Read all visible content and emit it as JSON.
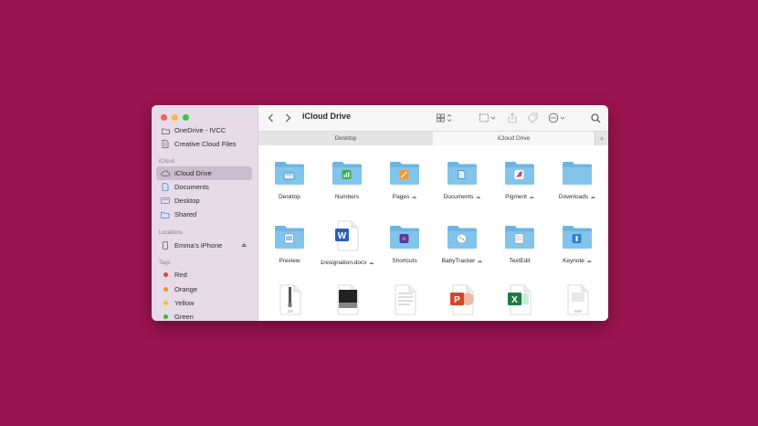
{
  "colors": {
    "background": "#9a1450",
    "folder": "#6db5e0",
    "selected": "#cbbdcd"
  },
  "sidebar": {
    "top_items": [
      {
        "label": "OneDrive - IVCC",
        "icon": "folder-icon"
      },
      {
        "label": "Creative Cloud Files",
        "icon": "document-icon"
      }
    ],
    "icloud_heading": "iCloud",
    "icloud_items": [
      {
        "label": "iCloud Drive",
        "icon": "cloud-icon",
        "selected": true
      },
      {
        "label": "Documents",
        "icon": "document-icon"
      },
      {
        "label": "Desktop",
        "icon": "desktop-icon"
      },
      {
        "label": "Shared",
        "icon": "shared-folder-icon"
      }
    ],
    "locations_heading": "Locations",
    "location_items": [
      {
        "label": "Emma's iPhone",
        "icon": "iphone-icon"
      }
    ],
    "tags_heading": "Tags",
    "tags": [
      {
        "label": "Red",
        "color": "#e8423a"
      },
      {
        "label": "Orange",
        "color": "#f0922c"
      },
      {
        "label": "Yellow",
        "color": "#f2c42c"
      },
      {
        "label": "Green",
        "color": "#3cb44a"
      }
    ]
  },
  "toolbar": {
    "title": "iCloud Drive"
  },
  "tabs": [
    {
      "label": "Desktop",
      "active": false
    },
    {
      "label": "iCloud Drive",
      "active": true
    }
  ],
  "files_row1": [
    {
      "label": "Desktop",
      "cloud": false,
      "badge": "desktop"
    },
    {
      "label": "Numbers",
      "cloud": false,
      "badge": "numbers"
    },
    {
      "label": "Pages",
      "cloud": true,
      "badge": "pages"
    },
    {
      "label": "Documents",
      "cloud": true,
      "badge": "documents"
    },
    {
      "label": "Pigment",
      "cloud": true,
      "badge": "pigment"
    },
    {
      "label": "Downloads",
      "cloud": true,
      "badge": "downloads"
    }
  ],
  "files_row2": [
    {
      "label": "Preview",
      "cloud": false,
      "badge": "preview"
    },
    {
      "label": "1resignation.docx",
      "cloud": true,
      "badge": "word"
    },
    {
      "label": "Shortcuts",
      "cloud": false,
      "badge": "shortcuts"
    },
    {
      "label": "BabyTracker",
      "cloud": true,
      "badge": "babytracker"
    },
    {
      "label": "TextEdit",
      "cloud": false,
      "badge": "textedit"
    },
    {
      "label": "Keynote",
      "cloud": true,
      "badge": "keynote"
    }
  ],
  "files_row3": [
    {
      "label": "ZIP",
      "kind": "zip"
    },
    {
      "label": "",
      "kind": "image"
    },
    {
      "label": "",
      "kind": "doc"
    },
    {
      "label": "",
      "kind": "powerpoint"
    },
    {
      "label": "",
      "kind": "excel"
    },
    {
      "label": "PDF",
      "kind": "pdf"
    }
  ]
}
